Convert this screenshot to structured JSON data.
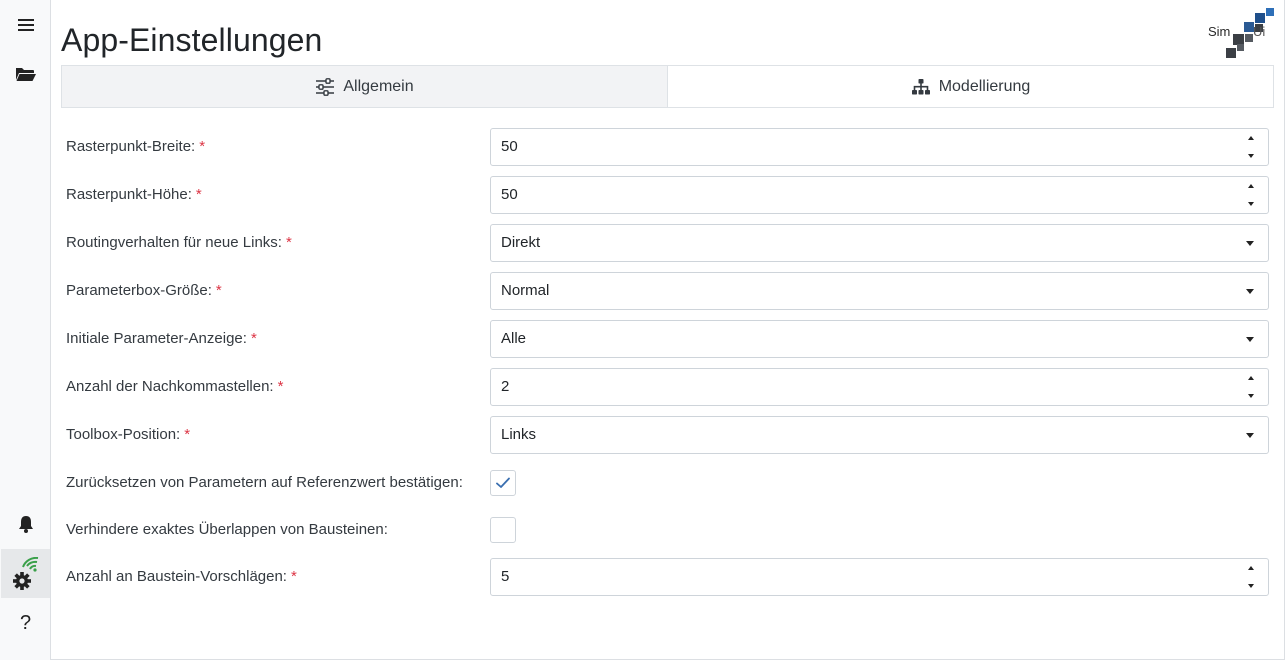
{
  "header": {
    "title": "App-Einstellungen"
  },
  "logo": {
    "text_left": "Sim",
    "text_right": "Ui"
  },
  "sidebar": {
    "items": [
      {
        "name": "menu",
        "icon": "hamburger-icon"
      },
      {
        "name": "open",
        "icon": "folder-open-icon"
      },
      {
        "name": "notifications",
        "icon": "bell-icon"
      },
      {
        "name": "settings",
        "icon": "gear-wifi-icon",
        "active": true
      },
      {
        "name": "help",
        "icon": "question-icon",
        "label": "?"
      }
    ]
  },
  "tabs": [
    {
      "label": "Allgemein",
      "icon": "sliders-icon",
      "active": true
    },
    {
      "label": "Modellierung",
      "icon": "sitemap-icon",
      "active": false
    }
  ],
  "required_mark": "*",
  "settings": [
    {
      "label": "Rasterpunkt-Breite:",
      "value": "50",
      "type": "number",
      "required": true
    },
    {
      "label": "Rasterpunkt-Höhe:",
      "value": "50",
      "type": "number",
      "required": true
    },
    {
      "label": "Routingverhalten für neue Links:",
      "value": "Direkt",
      "type": "select",
      "required": true
    },
    {
      "label": "Parameterbox-Größe:",
      "value": "Normal",
      "type": "select",
      "required": true
    },
    {
      "label": "Initiale Parameter-Anzeige:",
      "value": "Alle",
      "type": "select",
      "required": true
    },
    {
      "label": "Anzahl der Nachkommastellen:",
      "value": "2",
      "type": "number",
      "required": true
    },
    {
      "label": "Toolbox-Position:",
      "value": "Links",
      "type": "select",
      "required": true
    },
    {
      "label": "Zurücksetzen von Parametern auf Referenzwert bestätigen:",
      "checked": true,
      "type": "checkbox",
      "required": false
    },
    {
      "label": "Verhindere exaktes Überlappen von Bausteinen:",
      "checked": false,
      "type": "checkbox",
      "required": false
    },
    {
      "label": "Anzahl an Baustein-Vorschlägen:",
      "value": "5",
      "type": "number",
      "required": true
    }
  ],
  "colors": {
    "required": "#dc3545",
    "check": "#3a6fb0",
    "wifi": "#3aa04a",
    "logo_blue": "#1f4f8b",
    "logo_dark": "#3b3f45"
  }
}
